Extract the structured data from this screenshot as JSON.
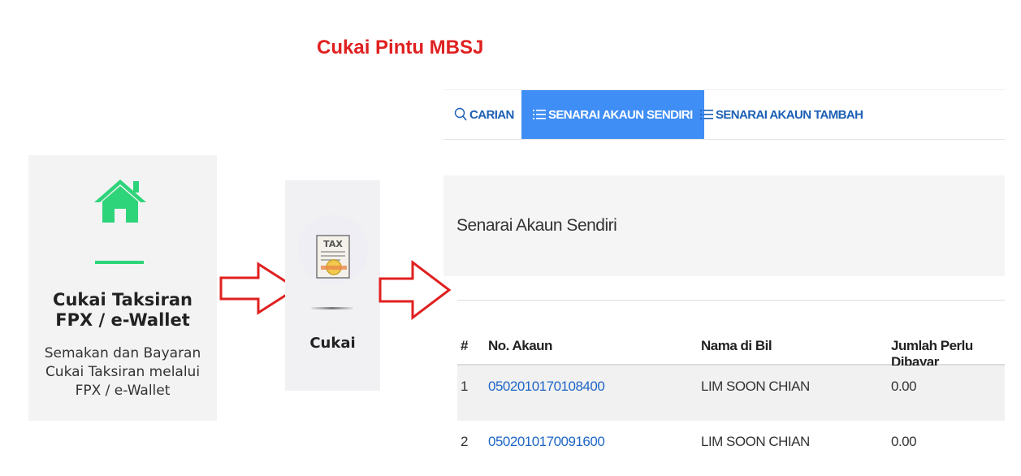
{
  "page_title": "Cukai Pintu MBSJ",
  "card_assessment": {
    "icon": "home-icon",
    "title_lines": [
      "Cukai Taksiran",
      "FPX / e-Wallet"
    ],
    "description_lines": [
      "Semakan dan Bayaran",
      "Cukai Taksiran melalui",
      "FPX / e-Wallet"
    ],
    "accent_color": "#2ED47A"
  },
  "card_tax": {
    "icon": "tax-document-icon",
    "icon_text": "TAX",
    "label": "Cukai"
  },
  "tabs": [
    {
      "icon": "search-icon",
      "label": "CARIAN",
      "active": false
    },
    {
      "icon": "list-icon",
      "label": "SENARAI AKAUN SENDIRI",
      "active": true
    },
    {
      "icon": "list-icon",
      "label": "SENARAI AKAUN TAMBAH",
      "active": false
    }
  ],
  "panel": {
    "title": "Senarai Akaun Sendiri"
  },
  "table": {
    "headers": [
      "#",
      "No. Akaun",
      "Nama di Bil",
      "Jumlah Perlu Dibayar"
    ],
    "rows": [
      [
        "1",
        "0502010170108400",
        "LIM SOON CHIAN",
        "0.00"
      ],
      [
        "2",
        "0502010170091600",
        "LIM SOON CHIAN",
        "0.00"
      ]
    ]
  },
  "colors": {
    "title_red": "#E02020",
    "arrow_red": "#E02020",
    "tab_active_bg": "#3F8EF5",
    "link_blue": "#1F66C7"
  }
}
